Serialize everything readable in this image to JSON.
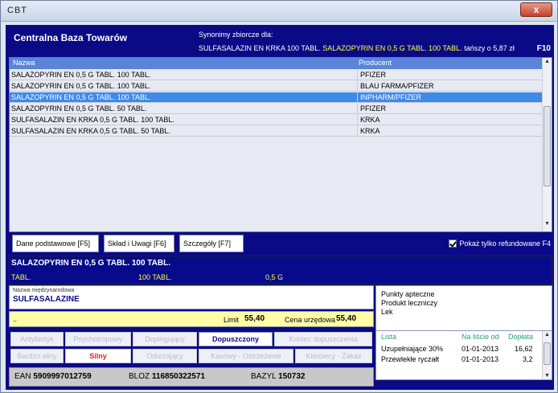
{
  "window": {
    "title": "CBT",
    "close_label": "x"
  },
  "header": {
    "app_title": "Centralna Baza Towarów",
    "synonyms_label": "Synonimy zbiorcze dla:",
    "synonym_1": "SULFASALAZIN EN KRKA 100 TABL.",
    "synonym_2": "SALAZOPYRIN EN 0,5 G TABL. 100 TABL.",
    "synonym_2_note": "tańszy o 5,87 zł",
    "hotkey": "F10"
  },
  "grid": {
    "columns": [
      "Nazwa",
      "Producent"
    ],
    "selected_index": 2,
    "rows": [
      {
        "name": "SALAZOPYRIN EN 0,5 G TABL. 100 TABL.",
        "producer": "PFIZER"
      },
      {
        "name": "SALAZOPYRIN EN 0,5 G TABL. 100 TABL.",
        "producer": "BLAU FARMA/PFIZER"
      },
      {
        "name": "SALAZOPYRIN EN 0,5 G TABL. 100 TABL.",
        "producer": "INPHARM/PFIZER"
      },
      {
        "name": "SALAZOPYRIN EN 0,5 G TABL. 50 TABL.",
        "producer": "PFIZER"
      },
      {
        "name": "SULFASALAZIN EN KRKA 0,5 G TABL. 100 TABL.",
        "producer": "KRKA"
      },
      {
        "name": "SULFASALAZIN EN KRKA 0,5 G TABL. 50 TABL.",
        "producer": "KRKA"
      }
    ]
  },
  "tabs": [
    "Dane podstawowe [F5]",
    "Skład i Uwagi [F6]",
    "Szczegóły [F7]"
  ],
  "refund_filter": {
    "label": "Pokaż tylko refundowane F4",
    "checked": true
  },
  "product": {
    "name": "SALAZOPYRIN EN 0,5 G TABL. 100 TABL.",
    "form": "TABL.",
    "package": "100 TABL.",
    "dose": "0,5 G"
  },
  "international_name": {
    "label": "Nazwa międzynarodowa",
    "value": "SULFASALAZINE"
  },
  "category": [
    "Punkty apteczne",
    "Produkt leczniczy",
    "Lek"
  ],
  "limits": {
    "dots": "..",
    "limit_label": "Limit",
    "limit_value": "55,40",
    "official_label": "Cena urzędowa",
    "official_value": "55,40"
  },
  "flags_row1": [
    "Antybiotyk",
    "Psychotropowy",
    "Dopingujący",
    "Dopuszczony",
    "Koniec dopuszczenia"
  ],
  "flags_row2": [
    "Bardzo silny",
    "Silny",
    "Odurzający",
    "Kasowy - Ostrzeżenie",
    "Kierowcy - Zakaz"
  ],
  "refund": {
    "headers": [
      "Lista",
      "Na liście od",
      "Dopłata"
    ],
    "rows": [
      {
        "list": "Uzupełniające 30%",
        "since": "01-01-2013",
        "copay": "16,62"
      },
      {
        "list": "Przewlekłe ryczałt",
        "since": "01-01-2013",
        "copay": "3,2"
      }
    ]
  },
  "codes": {
    "ean_label": "EAN",
    "ean": "5909997012759",
    "bloz_label": "BLOZ",
    "bloz": "116850322571",
    "bazyl_label": "BAZYL",
    "bazyl": "150732"
  },
  "colors": {
    "panel_blue": "#0a0a86",
    "highlight_yellow": "#ffff3c",
    "selected_row": "#3d8ae8",
    "limit_bar": "#ffffa8",
    "strong_red": "#e51b1b",
    "refund_header_green": "#2c9a78"
  },
  "icons": {
    "close": "close-icon",
    "scroll_up": "scroll-up-icon",
    "scroll_down": "scroll-down-icon",
    "checkbox": "checkbox-checked-icon"
  }
}
